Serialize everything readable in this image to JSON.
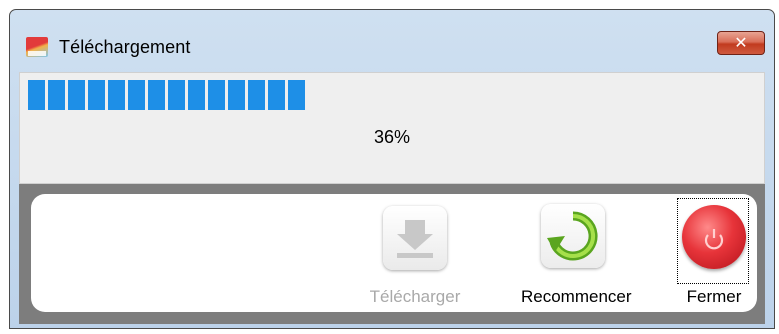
{
  "window": {
    "title": "Téléchargement",
    "close_symbol": "✕",
    "icon": "app-logo-icon"
  },
  "progress": {
    "fraction": 0.36,
    "percent_label": "36%",
    "color": "#1e8fe7"
  },
  "toolbar": {
    "download": {
      "label": "Télécharger",
      "enabled": false,
      "icon": "download-icon"
    },
    "restart": {
      "label": "Recommencer",
      "enabled": true,
      "icon": "refresh-icon"
    },
    "close": {
      "label": "Fermer",
      "enabled": true,
      "focused": true,
      "icon": "power-icon"
    }
  }
}
